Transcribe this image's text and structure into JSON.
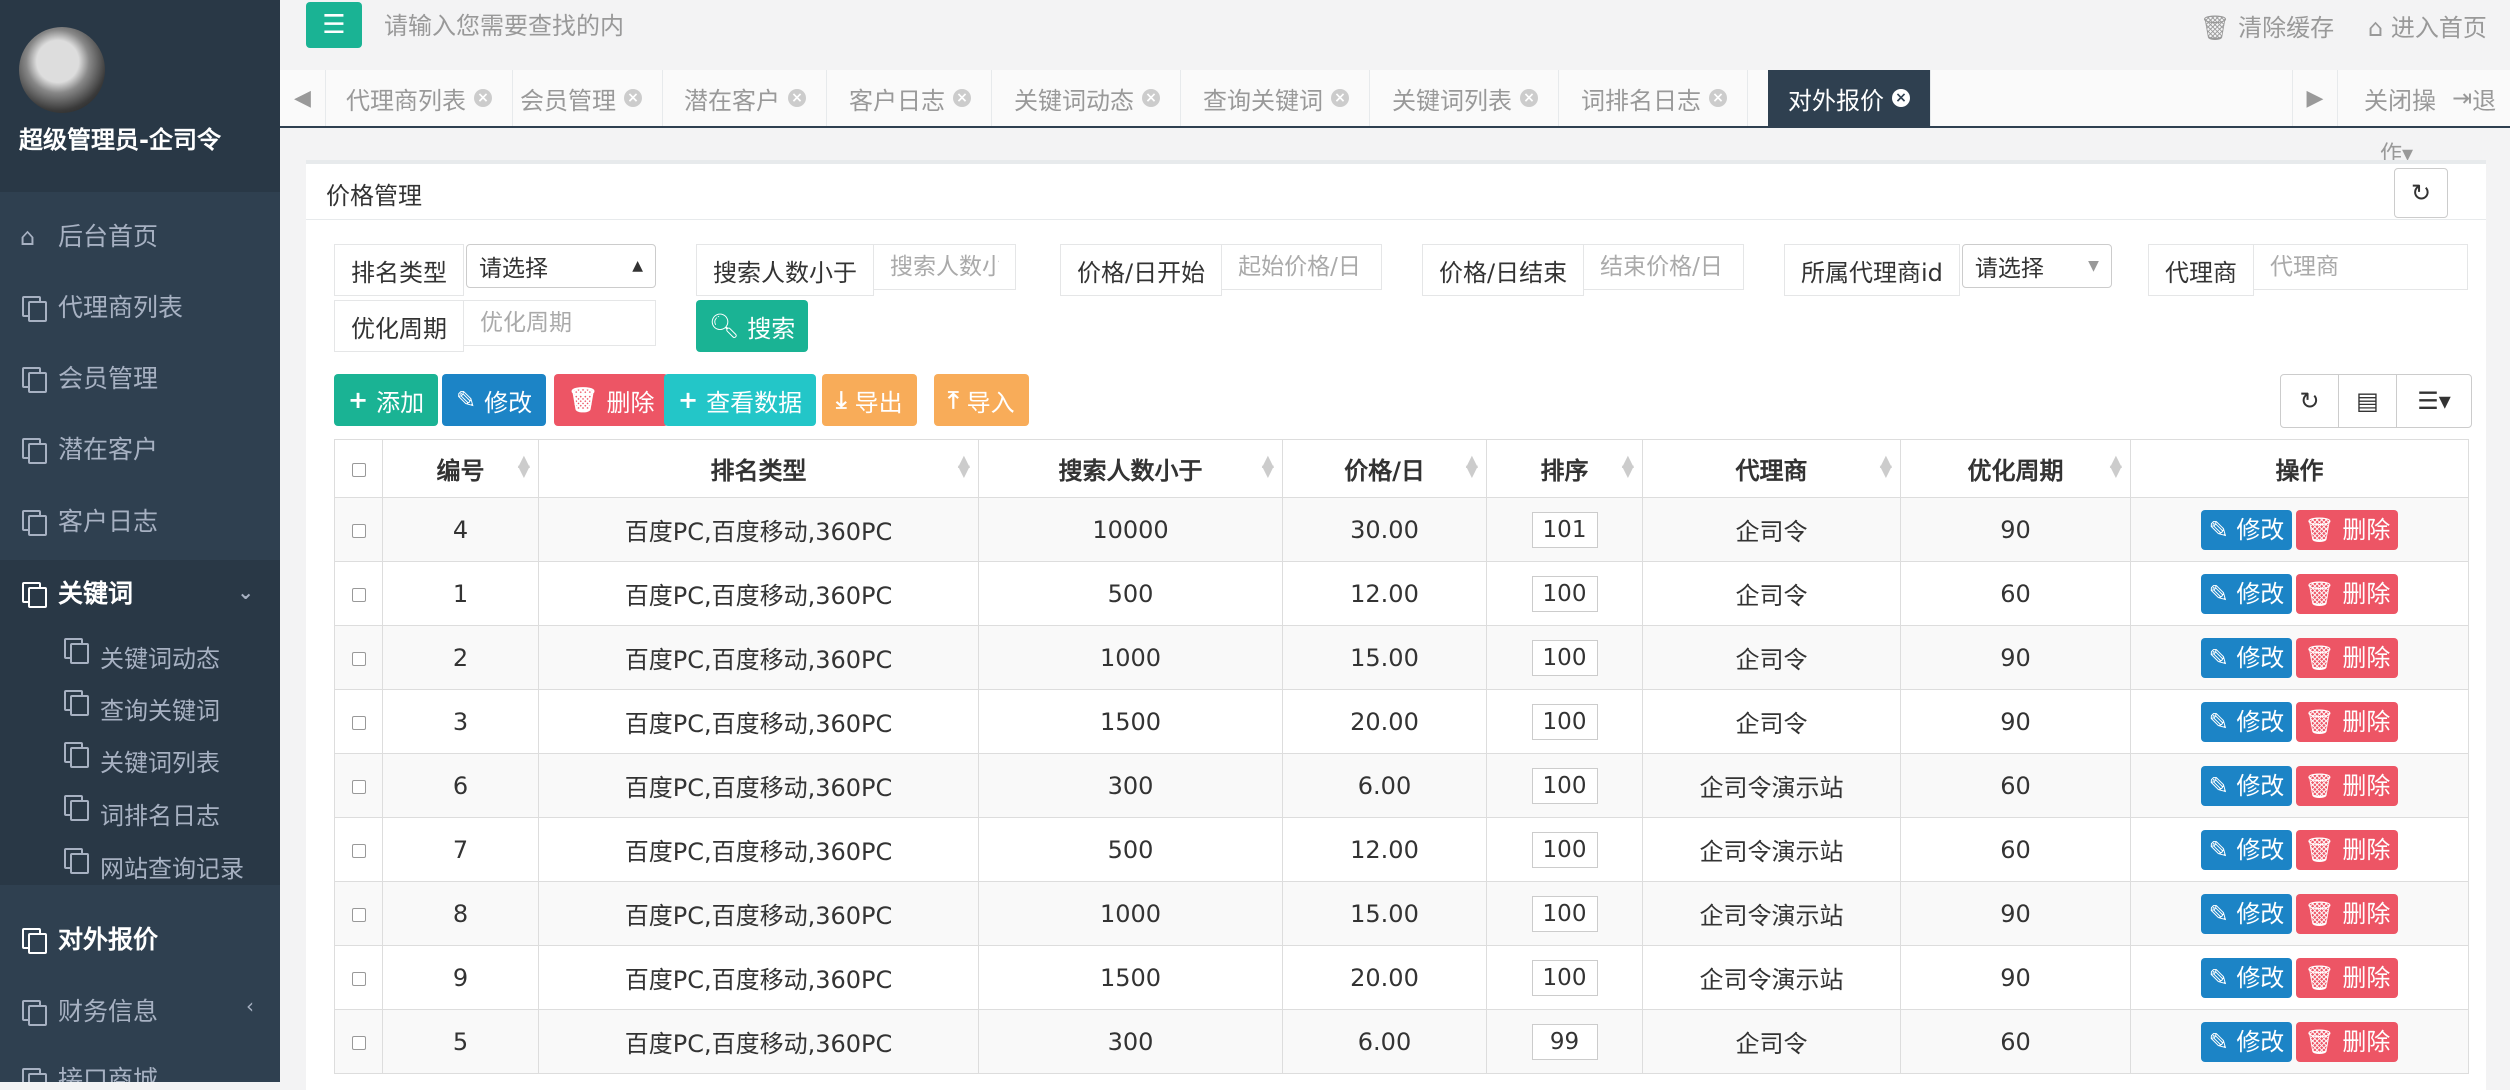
{
  "sidebar": {
    "user_name": "超级管理员-企司令",
    "items": [
      {
        "label": "后台首页",
        "icon": "home-icon"
      },
      {
        "label": "代理商列表",
        "icon": "copy-icon"
      },
      {
        "label": "会员管理",
        "icon": "copy-icon"
      },
      {
        "label": "潜在客户",
        "icon": "copy-icon"
      },
      {
        "label": "客户日志",
        "icon": "copy-icon"
      },
      {
        "label": "关键词",
        "icon": "copy-icon"
      },
      {
        "label": "对外报价",
        "icon": "copy-icon"
      },
      {
        "label": "财务信息",
        "icon": "copy-icon"
      },
      {
        "label": "接口商城",
        "icon": "copy-icon"
      }
    ],
    "sub_items": [
      {
        "label": "关键词动态"
      },
      {
        "label": "查询关键词"
      },
      {
        "label": "关键词列表"
      },
      {
        "label": "词排名日志"
      },
      {
        "label": "网站查询记录"
      }
    ]
  },
  "topbar": {
    "search_placeholder": "请输入您需要查找的内",
    "clear_cache": "清除缓存",
    "go_home": "进入首页"
  },
  "tabs": {
    "items": [
      {
        "label": "代理商列表"
      },
      {
        "label": "会员管理"
      },
      {
        "label": "潜在客户"
      },
      {
        "label": "客户日志"
      },
      {
        "label": "关键词动态"
      },
      {
        "label": "查询关键词"
      },
      {
        "label": "关键词列表"
      },
      {
        "label": "词排名日志"
      },
      {
        "label": "对外报价"
      }
    ],
    "close_ops": "关闭操",
    "close_ops_tail": "作",
    "logout": "退"
  },
  "panel": {
    "title": "价格管理"
  },
  "filters": {
    "rank_type_label": "排名类型",
    "rank_type_value": "请选择",
    "search_count_label": "搜索人数小于",
    "search_count_placeholder": "搜索人数小",
    "price_start_label": "价格/日开始",
    "price_start_placeholder": "起始价格/日",
    "price_end_label": "价格/日结束",
    "price_end_placeholder": "结束价格/日",
    "agent_id_label": "所属代理商id",
    "agent_id_value": "请选择",
    "agent_label": "代理商",
    "agent_placeholder": "代理商",
    "period_label": "优化周期",
    "period_placeholder": "优化周期",
    "search_button": "搜索"
  },
  "toolbar": {
    "add": "添加",
    "edit": "修改",
    "delete": "删除",
    "view": "查看数据",
    "export": "导出",
    "import": "导入"
  },
  "table": {
    "columns": [
      "编号",
      "排名类型",
      "搜索人数小于",
      "价格/日",
      "排序",
      "代理商",
      "优化周期",
      "操作"
    ],
    "edit_label": "修改",
    "delete_label": "删除",
    "rows": [
      {
        "id": "4",
        "type": "百度PC,百度移动,360PC",
        "count": "10000",
        "price": "30.00",
        "sort": "101",
        "agent": "企司令",
        "period": "90"
      },
      {
        "id": "1",
        "type": "百度PC,百度移动,360PC",
        "count": "500",
        "price": "12.00",
        "sort": "100",
        "agent": "企司令",
        "period": "60"
      },
      {
        "id": "2",
        "type": "百度PC,百度移动,360PC",
        "count": "1000",
        "price": "15.00",
        "sort": "100",
        "agent": "企司令",
        "period": "90"
      },
      {
        "id": "3",
        "type": "百度PC,百度移动,360PC",
        "count": "1500",
        "price": "20.00",
        "sort": "100",
        "agent": "企司令",
        "period": "90"
      },
      {
        "id": "6",
        "type": "百度PC,百度移动,360PC",
        "count": "300",
        "price": "6.00",
        "sort": "100",
        "agent": "企司令演示站",
        "period": "60"
      },
      {
        "id": "7",
        "type": "百度PC,百度移动,360PC",
        "count": "500",
        "price": "12.00",
        "sort": "100",
        "agent": "企司令演示站",
        "period": "60"
      },
      {
        "id": "8",
        "type": "百度PC,百度移动,360PC",
        "count": "1000",
        "price": "15.00",
        "sort": "100",
        "agent": "企司令演示站",
        "period": "90"
      },
      {
        "id": "9",
        "type": "百度PC,百度移动,360PC",
        "count": "1500",
        "price": "20.00",
        "sort": "100",
        "agent": "企司令演示站",
        "period": "90"
      },
      {
        "id": "5",
        "type": "百度PC,百度移动,360PC",
        "count": "300",
        "price": "6.00",
        "sort": "99",
        "agent": "企司令",
        "period": "60"
      }
    ]
  },
  "colors": {
    "sidebar_bg": "#2f4050",
    "primary": "#1ab394",
    "edit_blue": "#1c84c6",
    "delete_red": "#ed5565",
    "info_cyan": "#23c6c8",
    "warning_orange": "#f8ac59"
  }
}
